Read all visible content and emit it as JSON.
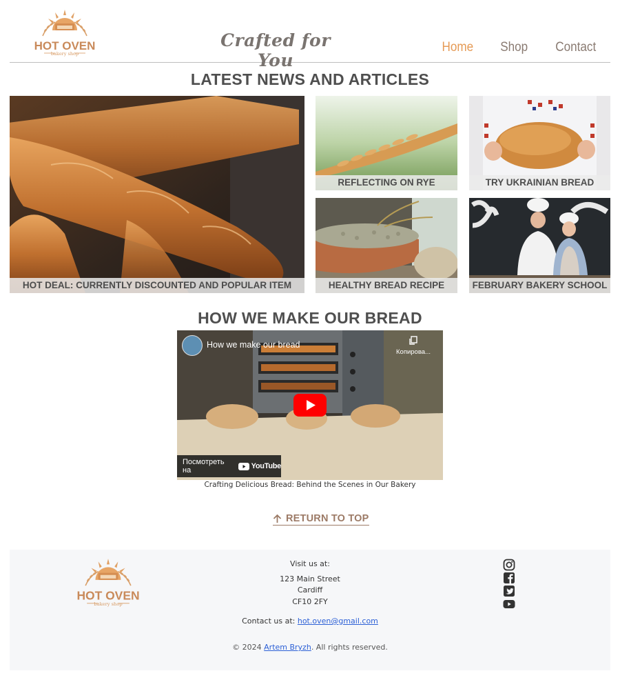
{
  "header": {
    "logo": {
      "main": "HOT OVEN",
      "sub": "bakery shop"
    },
    "tagline": "Crafted for You",
    "nav": [
      {
        "label": "Home",
        "active": true
      },
      {
        "label": "Shop",
        "active": false
      },
      {
        "label": "Contact",
        "active": false
      }
    ]
  },
  "news": {
    "title": "LATEST NEWS AND ARTICLES",
    "articles": [
      {
        "caption": "HOT DEAL: CURRENTLY DISCOUNTED AND POPULAR ITEM"
      },
      {
        "caption": "REFLECTING ON RYE"
      },
      {
        "caption": "TRY UKRAINIAN BREAD"
      },
      {
        "caption": "HEALTHY BREAD RECIPE"
      },
      {
        "caption": "FEBRUARY BAKERY SCHOOL"
      }
    ]
  },
  "video": {
    "section_title": "HOW WE MAKE OUR BREAD",
    "title": "How we make our bread",
    "copy_label": "Копирова...",
    "watch_label": "Посмотреть на",
    "youtube_word": "YouTube",
    "caption": "Crafting Delicious Bread: Behind the Scenes in Our Bakery"
  },
  "return_to_top": {
    "label": "RETURN TO TOP",
    "icon": "arrow-up-icon"
  },
  "footer": {
    "logo": {
      "main": "HOT OVEN",
      "sub": "bakery shop"
    },
    "visit_label": "Visit us at:",
    "address": [
      "123 Main Street",
      "Cardiff",
      "CF10 2FY"
    ],
    "contact_label": "Contact us at:",
    "email": "hot.oven@gmail.com",
    "copyright_prefix": "© 2024",
    "author": "Artem Bryzh",
    "copyright_suffix": ". All rights reserved.",
    "social_icons": [
      "instagram-icon",
      "facebook-icon",
      "twitter-icon",
      "youtube-icon"
    ]
  },
  "colors": {
    "accent": "#e59a55",
    "logo_brown": "#c98a5a",
    "nav_text": "#8a7b72",
    "link_blue": "#2b5fd6",
    "footer_bg": "#f6f7f9",
    "youtube_red": "#ff0000"
  }
}
